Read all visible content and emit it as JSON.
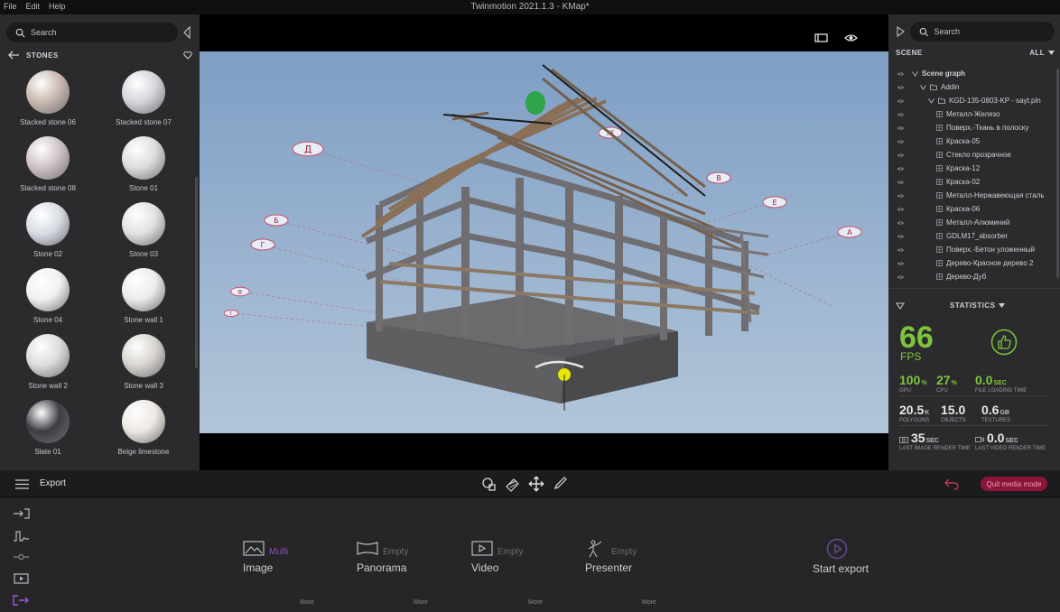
{
  "menu": [
    "File",
    "Edit",
    "Help"
  ],
  "window_title": "Twinmotion 2021.1.3 - KMap*",
  "left_panel": {
    "search_placeholder": "Search",
    "library_title": "STONES",
    "materials": [
      {
        "name": "Stacked stone 06",
        "color": "#c9b8b0"
      },
      {
        "name": "Stacked stone 07",
        "color": "#d5d6dc"
      },
      {
        "name": "Stacked stone 08",
        "color": "#cfc2c4"
      },
      {
        "name": "Stone 01",
        "color": "#dddddd"
      },
      {
        "name": "Stone 02",
        "color": "#d8dde4"
      },
      {
        "name": "Stone 03",
        "color": "#e2e2e2"
      },
      {
        "name": "Stone 04",
        "color": "#f1f1f1"
      },
      {
        "name": "Stone wall 1",
        "color": "#ececec"
      },
      {
        "name": "Stone wall 2",
        "color": "#dcdcdc"
      },
      {
        "name": "Stone wall 3",
        "color": "#d8d5cf"
      },
      {
        "name": "Slate 01",
        "color": "#3d3d44"
      },
      {
        "name": "Beige limestone",
        "color": "#ece8e2"
      }
    ]
  },
  "viewport": {
    "sign_labels": [
      "Д",
      "Б",
      "Г",
      "В",
      "Е",
      "В",
      "Ж",
      "Г",
      "А"
    ]
  },
  "right_panel": {
    "search_placeholder": "Search",
    "scene_label": "SCENE",
    "filter_label": "ALL",
    "tree": [
      {
        "label": "Scene graph",
        "level": 0,
        "type": "root"
      },
      {
        "label": "Addin",
        "level": 1,
        "type": "folder"
      },
      {
        "label": "KGD-135-0803-KP - sayt.pln",
        "level": 2,
        "type": "folder"
      },
      {
        "label": "Металл-Железо",
        "level": 3,
        "type": "material"
      },
      {
        "label": "Поверх.-Ткань в полоску",
        "level": 3,
        "type": "material"
      },
      {
        "label": "Краска-05",
        "level": 3,
        "type": "material"
      },
      {
        "label": "Стекло прозрачное",
        "level": 3,
        "type": "material"
      },
      {
        "label": "Краска-12",
        "level": 3,
        "type": "material"
      },
      {
        "label": "Краска-02",
        "level": 3,
        "type": "material"
      },
      {
        "label": "Металл-Нержавеющая сталь",
        "level": 3,
        "type": "material"
      },
      {
        "label": "Краска-06",
        "level": 3,
        "type": "material"
      },
      {
        "label": "Металл-Алюминий",
        "level": 3,
        "type": "material"
      },
      {
        "label": "GDLM17_absorber",
        "level": 3,
        "type": "material"
      },
      {
        "label": "Поверх.-Бетон уложенный",
        "level": 3,
        "type": "material"
      },
      {
        "label": "Дерево-Красное дерево 2",
        "level": 3,
        "type": "material"
      },
      {
        "label": "Дерево-Дуб",
        "level": 3,
        "type": "material"
      }
    ],
    "statistics": {
      "title": "STATISTICS",
      "fps": "66",
      "fps_label": "FPS",
      "gpu": {
        "value": "100",
        "unit": "%",
        "label": "GPU"
      },
      "cpu": {
        "value": "27",
        "unit": "%",
        "label": "CPU"
      },
      "file_loading": {
        "value": "0.0",
        "unit": "SEC",
        "label": "FILE LOADING TIME"
      },
      "polygons": {
        "value": "20.5",
        "unit": "K",
        "label": "POLYGONS"
      },
      "objects": {
        "value": "15.0",
        "unit": "",
        "label": "OBJECTS"
      },
      "textures": {
        "value": "0.6",
        "unit": "GB",
        "label": "TEXTURES"
      },
      "last_image": {
        "value": "35",
        "unit": "SEC",
        "label": "LAST IMAGE RENDER TIME"
      },
      "last_video": {
        "value": "0.0",
        "unit": "SEC",
        "label": "LAST VIDEO RENDER TIME"
      }
    }
  },
  "toolbar": {
    "section_label": "Export",
    "quit_label": "Quit media mode"
  },
  "export": {
    "items": [
      {
        "name": "Image",
        "status": "Multi",
        "status_color": "#8f4fc0",
        "more": "More"
      },
      {
        "name": "Panorama",
        "status": "Empty",
        "status_color": "#6c6c70",
        "more": "More"
      },
      {
        "name": "Video",
        "status": "Empty",
        "status_color": "#6c6c70",
        "more": "More"
      },
      {
        "name": "Presenter",
        "status": "Empty",
        "status_color": "#6c6c70",
        "more": "More"
      }
    ],
    "start_label": "Start export"
  }
}
